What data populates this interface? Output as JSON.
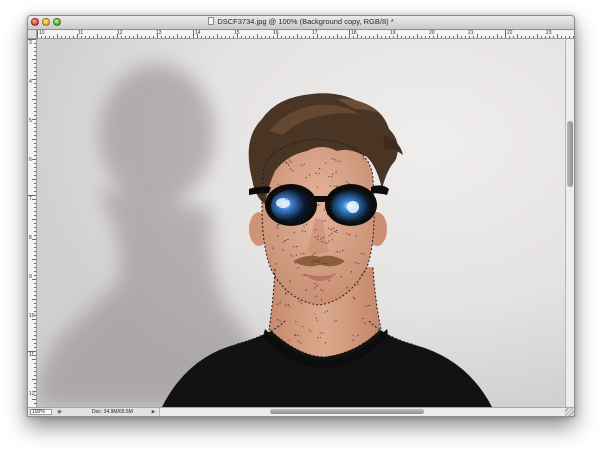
{
  "window": {
    "title": "DSCF3734.jpg @ 100% (Background copy, RGB/8) *",
    "buttons": [
      "close",
      "minimize",
      "zoom"
    ]
  },
  "rulers": {
    "horizontal_labels": [
      "10",
      "11",
      "12",
      "13",
      "14",
      "15",
      "16",
      "17",
      "18",
      "19",
      "20",
      "21",
      "22",
      "23"
    ],
    "vertical_labels": [
      "3",
      "4",
      "5",
      "6",
      "7",
      "8",
      "9",
      "10",
      "11",
      "12"
    ]
  },
  "status_bar": {
    "zoom": "100%",
    "doc_info": "Doc: 34.9M/65.5M",
    "info_icon": "document-info-icon",
    "arrow_icon": "triangle-right-icon"
  },
  "canvas": {
    "content": "photo-portrait-with-marching-ants-selection"
  },
  "colors": {
    "titlebar_top": "#ebebeb",
    "titlebar_bottom": "#c9c9c9",
    "canvas_bg": "#e6e4e4",
    "shirt": "#111111",
    "selection": "#2a2a2a"
  }
}
